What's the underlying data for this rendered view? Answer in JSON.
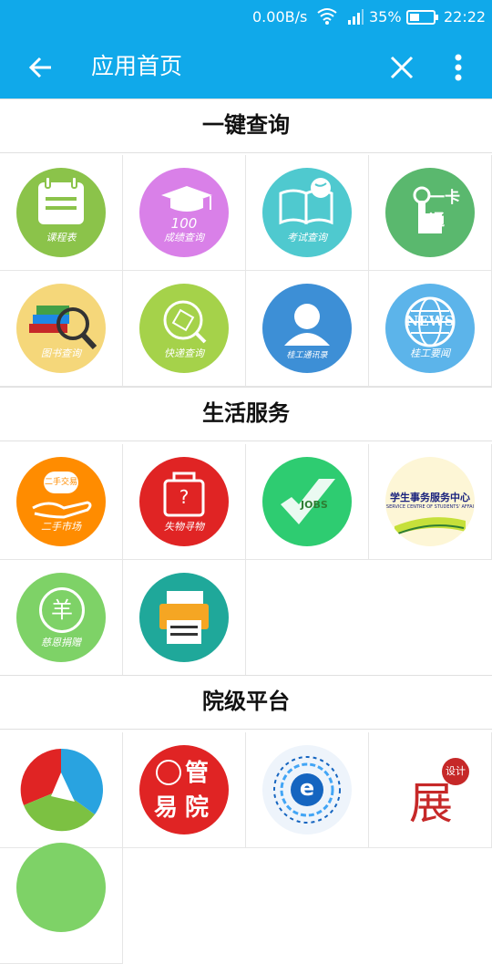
{
  "status_bar": {
    "net_speed": "0.00B/s",
    "battery": "35%",
    "time": "22:22"
  },
  "app_bar": {
    "title": "应用首页"
  },
  "sections": {
    "quick_query": "一键查询",
    "life_services": "生活服务",
    "college_platform": "院级平台"
  },
  "apps": {
    "schedule": "课程表",
    "grades": "成绩查询",
    "grades_num": "100",
    "exam": "考试查询",
    "card": "一卡通",
    "library": "图书查询",
    "express": "快递查询",
    "contacts": "桂工通讯录",
    "news_word": "NEWS",
    "news": "桂工要闻",
    "second_hand_badge": "二手交易",
    "second_hand": "二手市场",
    "lost_found_q": "?",
    "lost_found": "失物寻物",
    "jobs": "JOBS",
    "student_affairs_top": "学生事务服务中心",
    "student_affairs_sub": "SERVICE CENTRE OF STUDENTS' AFFAI",
    "donation_symbol": "羊",
    "donation": "慈恩捐赠",
    "mgmt_1": "管",
    "mgmt_2": "易",
    "mgmt_3": "院",
    "design_1": "展",
    "design_2": "设计",
    "e_letter": "e"
  },
  "colors": {
    "primary": "#10a9ea",
    "green": "#8bc34a",
    "purple": "#d980e8",
    "teal": "#4fc9cf",
    "green2": "#5ab86e",
    "yellow": "#f5d77a",
    "lime": "#a5d24a",
    "blue": "#3d8fd6",
    "sky": "#5cb4ea",
    "orange": "#ff8c00",
    "red": "#e02424"
  }
}
